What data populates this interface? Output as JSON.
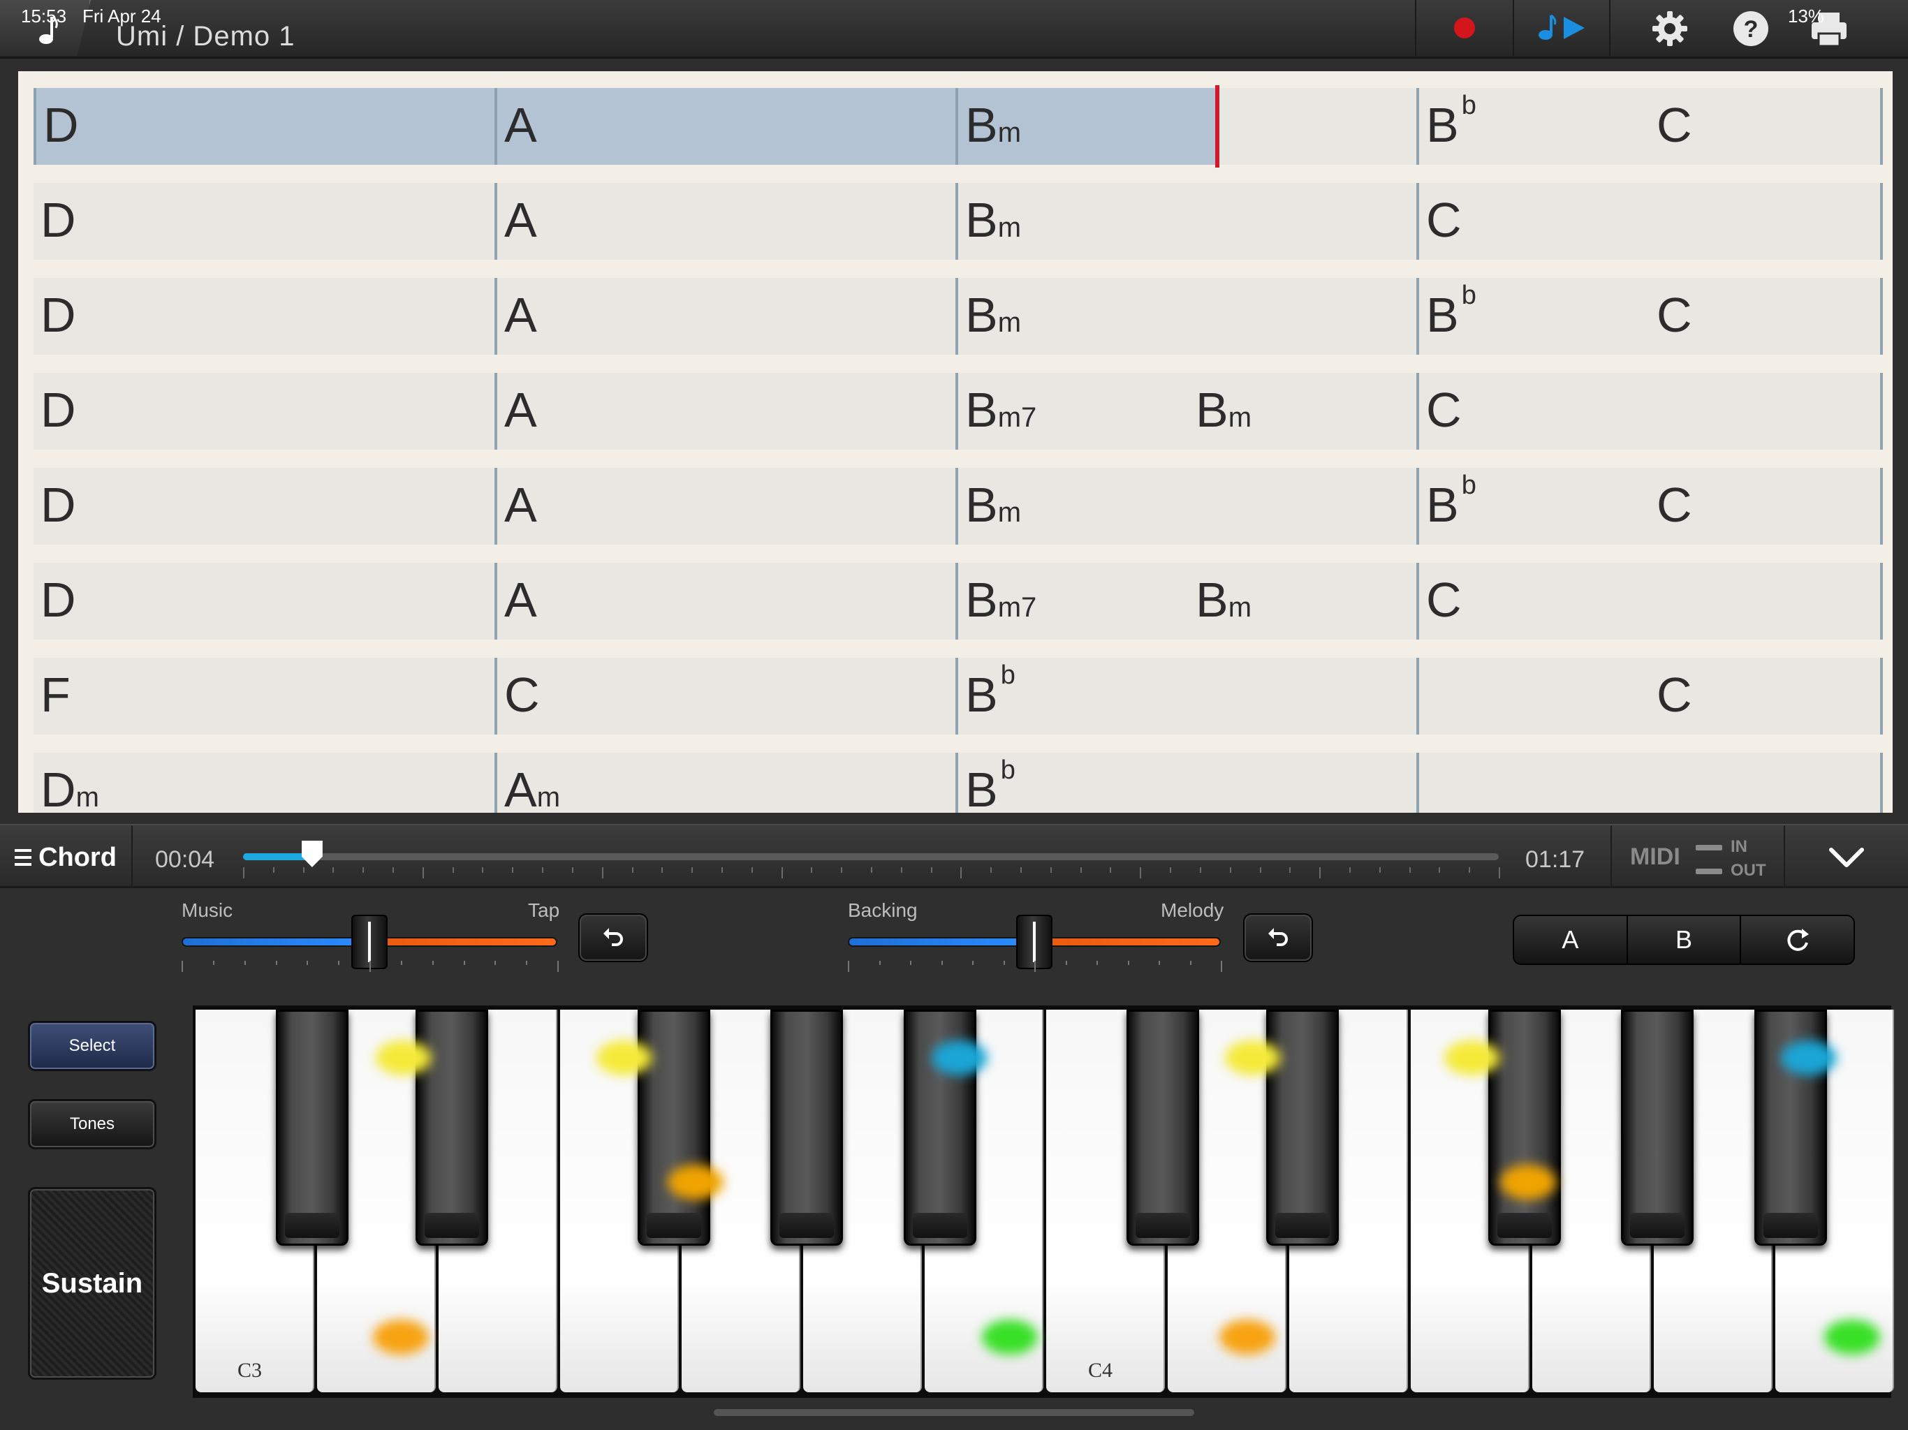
{
  "status": {
    "time": "15:53",
    "date": "Fri Apr 24",
    "battery": "13%"
  },
  "app": {
    "title": "Umi / Demo 1"
  },
  "toolbar": {
    "record": "record-icon",
    "play": "play-icon",
    "settings": "gear-icon",
    "help": "help-icon",
    "print": "print-icon"
  },
  "sheet": {
    "rows": [
      {
        "bars": [
          [
            {
              "r": "D"
            }
          ],
          [
            {
              "r": "A"
            }
          ],
          [
            {
              "r": "B",
              "q": "m"
            }
          ],
          [
            {
              "r": "B",
              "s": "b"
            },
            {
              "r": "C",
              "half": true
            }
          ]
        ],
        "highlight": true
      },
      {
        "bars": [
          [
            {
              "r": "D"
            }
          ],
          [
            {
              "r": "A"
            }
          ],
          [
            {
              "r": "B",
              "q": "m"
            }
          ],
          [
            {
              "r": "C"
            }
          ]
        ]
      },
      {
        "bars": [
          [
            {
              "r": "D"
            }
          ],
          [
            {
              "r": "A"
            }
          ],
          [
            {
              "r": "B",
              "q": "m"
            }
          ],
          [
            {
              "r": "B",
              "s": "b"
            },
            {
              "r": "C",
              "half": true
            }
          ]
        ]
      },
      {
        "bars": [
          [
            {
              "r": "D"
            }
          ],
          [
            {
              "r": "A"
            }
          ],
          [
            {
              "r": "B",
              "q": "m7"
            },
            {
              "r": "B",
              "q": "m",
              "half": true
            }
          ],
          [
            {
              "r": "C"
            }
          ]
        ]
      },
      {
        "bars": [
          [
            {
              "r": "D"
            }
          ],
          [
            {
              "r": "A"
            }
          ],
          [
            {
              "r": "B",
              "q": "m"
            }
          ],
          [
            {
              "r": "B",
              "s": "b"
            },
            {
              "r": "C",
              "half": true
            }
          ]
        ]
      },
      {
        "bars": [
          [
            {
              "r": "D"
            }
          ],
          [
            {
              "r": "A"
            }
          ],
          [
            {
              "r": "B",
              "q": "m7"
            },
            {
              "r": "B",
              "q": "m",
              "half": true
            }
          ],
          [
            {
              "r": "C"
            }
          ]
        ]
      },
      {
        "bars": [
          [
            {
              "r": "F"
            }
          ],
          [
            {
              "r": "C"
            }
          ],
          [
            {
              "r": "B",
              "s": "b"
            }
          ],
          [
            {
              "r": "C",
              "half": true
            }
          ]
        ]
      },
      {
        "bars": [
          [
            {
              "r": "D",
              "q": "m"
            }
          ],
          [
            {
              "r": "A",
              "q": "m"
            }
          ],
          [
            {
              "r": "B",
              "s": "b"
            }
          ],
          []
        ]
      }
    ]
  },
  "transport": {
    "mode_label": "Chord",
    "current_time": "00:04",
    "total_time": "01:17",
    "progress": 0.055,
    "midi_label": "MIDI",
    "midi_in": "IN",
    "midi_out": "OUT"
  },
  "mixer": {
    "music_label": "Music",
    "tap_label": "Tap",
    "music_tap_level": 0.5,
    "backing_label": "Backing",
    "melody_label": "Melody",
    "backing_melody_level": 0.5
  },
  "sections": {
    "a": "A",
    "b": "B"
  },
  "side": {
    "select": "Select",
    "tones": "Tones",
    "sustain": "Sustain"
  },
  "keyboard": {
    "label_c3": "C3",
    "label_c4": "C4"
  }
}
